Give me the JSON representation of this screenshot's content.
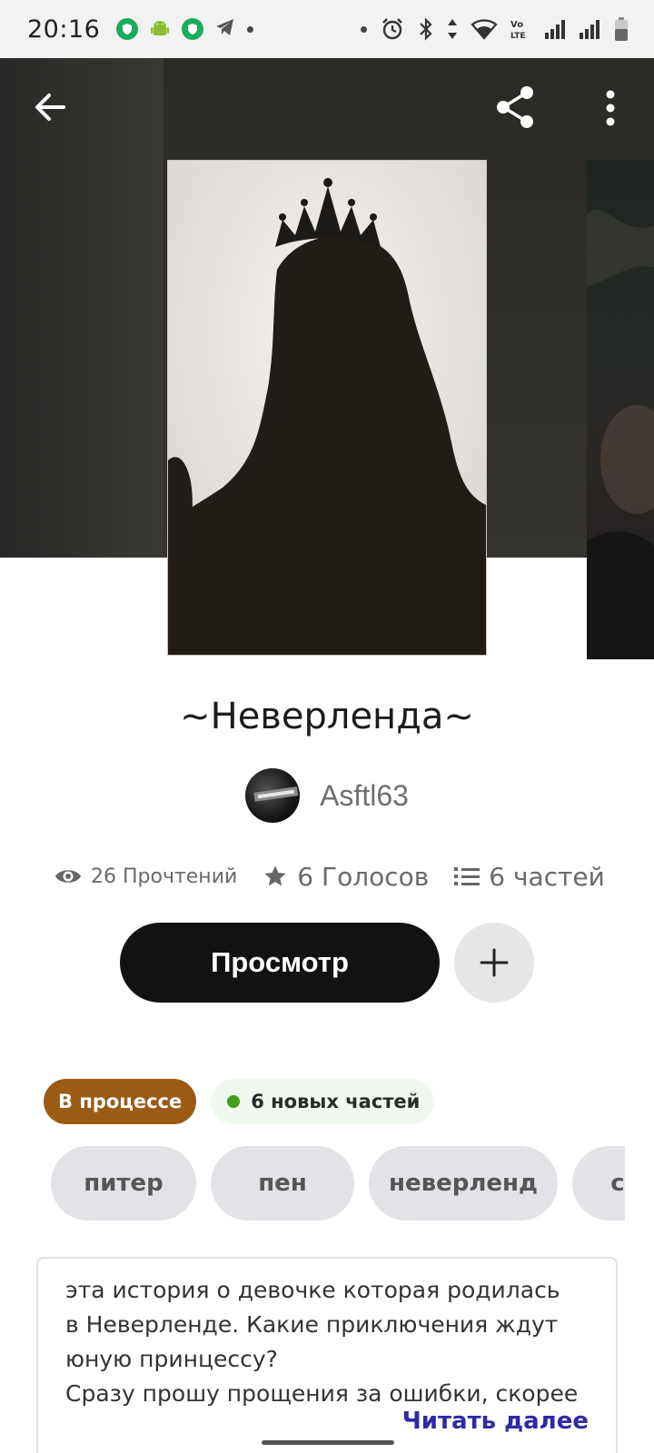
{
  "status_bar": {
    "time": "20:16",
    "notification_icons": [
      "shield-green-icon",
      "android-icon",
      "shield-green-icon",
      "telegram-icon",
      "dot-icon"
    ],
    "system_icons": [
      "dot-icon",
      "alarm-icon",
      "bluetooth-icon",
      "data-arrows-icon",
      "wifi-icon",
      "volte-icon",
      "signal-icon",
      "signal-icon",
      "battery-icon"
    ]
  },
  "header": {
    "back_icon": "arrow-left-icon",
    "share_icon": "share-icon",
    "more_icon": "more-vertical-icon"
  },
  "story": {
    "title": "~Неверленда~",
    "author": "Asftl63",
    "stats": {
      "reads": "26 Прочтений",
      "votes": "6 Голосов",
      "parts": "6 частей"
    },
    "read_button": "Просмотр",
    "status_badge": "В процессе",
    "new_parts_badge": "6 новых частей",
    "tags": [
      "питер",
      "пен",
      "неверленд",
      "с"
    ],
    "description": "эта история о девочке которая родилась\nв Неверленде. Какие приключения ждут\nюную принцессу?\nСразу прошу прощения за ошибки, скорее",
    "read_more": "Читать далее"
  },
  "colors": {
    "hero_bg": "#2f2e2b",
    "primary_button": "#121212",
    "progress_badge": "#9a5b14",
    "new_parts_dot": "#3fa11a",
    "read_more": "#2c2aa5"
  }
}
